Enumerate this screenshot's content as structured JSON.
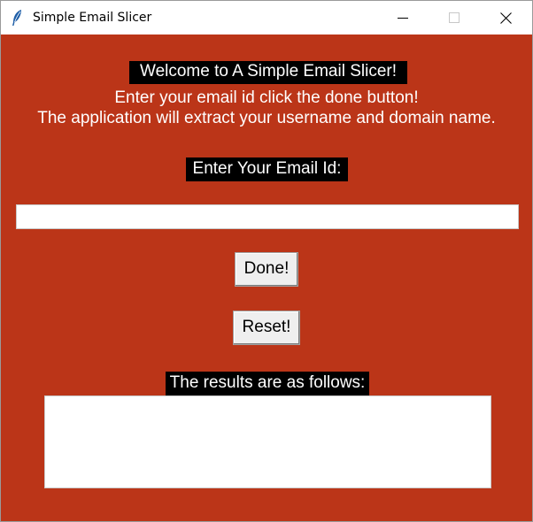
{
  "window": {
    "title": "Simple Email Slicer",
    "background": "#bb3518"
  },
  "icons": {
    "app": "feather-icon",
    "minimize": "minimize-icon",
    "maximize": "maximize-icon",
    "close": "close-icon"
  },
  "main": {
    "welcome": "Welcome to A Simple Email Slicer!",
    "instructions_line1": "Enter your email id click the done button!",
    "instructions_line2": "The application will extract your username and domain name.",
    "email_label": "Enter Your Email Id:",
    "email_value": "",
    "done_label": "Done!",
    "reset_label": "Reset!",
    "results_label": "The results are as follows:",
    "results_text": ""
  }
}
